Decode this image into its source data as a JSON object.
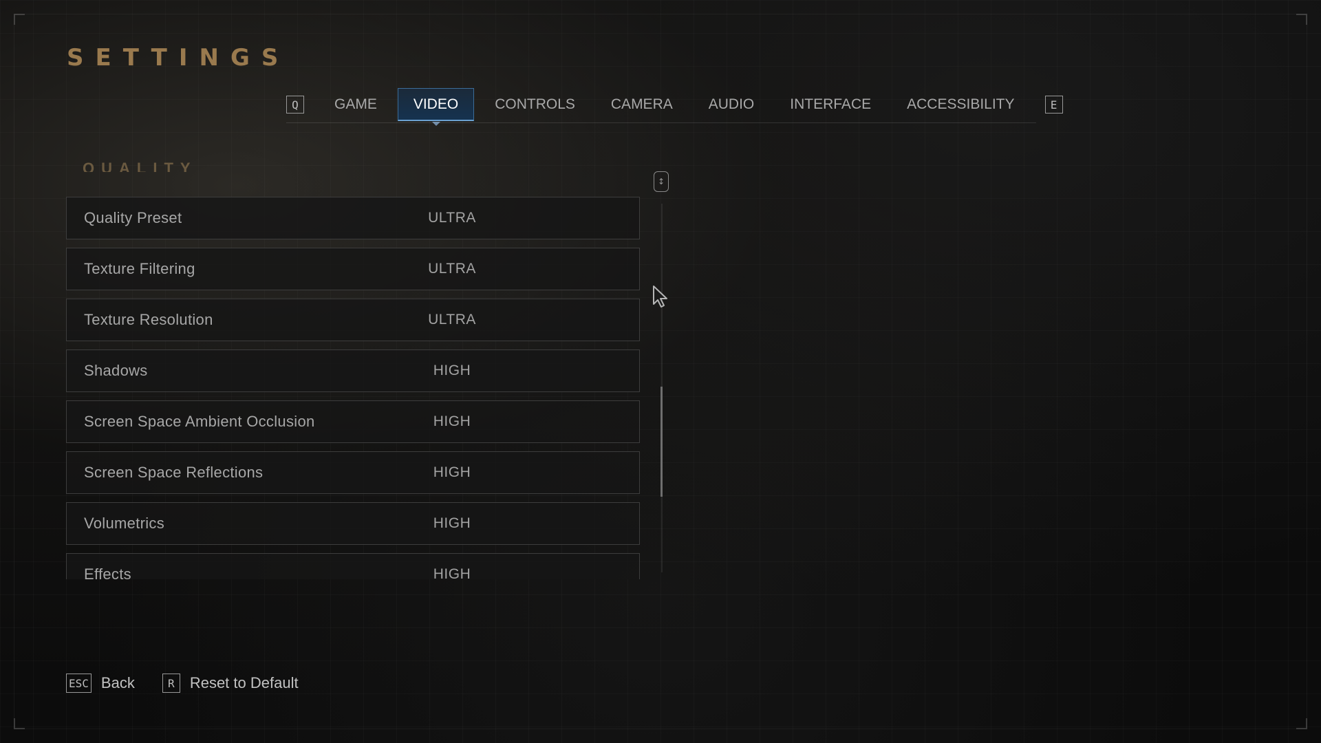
{
  "title": "SETTINGS",
  "tabs": {
    "prev_key": "Q",
    "next_key": "E",
    "items": [
      {
        "label": "GAME"
      },
      {
        "label": "VIDEO"
      },
      {
        "label": "CONTROLS"
      },
      {
        "label": "CAMERA"
      },
      {
        "label": "AUDIO"
      },
      {
        "label": "INTERFACE"
      },
      {
        "label": "ACCESSIBILITY"
      }
    ],
    "active": "VIDEO"
  },
  "section": {
    "heading": "QUALITY"
  },
  "settings": [
    {
      "label": "Quality Preset",
      "value": "ULTRA"
    },
    {
      "label": "Texture Filtering",
      "value": "ULTRA"
    },
    {
      "label": "Texture Resolution",
      "value": "ULTRA"
    },
    {
      "label": "Shadows",
      "value": "HIGH"
    },
    {
      "label": "Screen Space Ambient Occlusion",
      "value": "HIGH"
    },
    {
      "label": "Screen Space Reflections",
      "value": "HIGH"
    },
    {
      "label": "Volumetrics",
      "value": "HIGH"
    },
    {
      "label": "Effects",
      "value": "HIGH"
    }
  ],
  "footer": {
    "back_key": "ESC",
    "back_label": "Back",
    "reset_key": "R",
    "reset_label": "Reset to Default"
  },
  "colors": {
    "accent_gold": "#9a7a4e",
    "active_tab": "#15324f",
    "active_tab_border": "#6aa0d0"
  },
  "icons": {
    "scroll": "scroll-updown-icon",
    "cursor": "mouse-cursor-icon"
  }
}
